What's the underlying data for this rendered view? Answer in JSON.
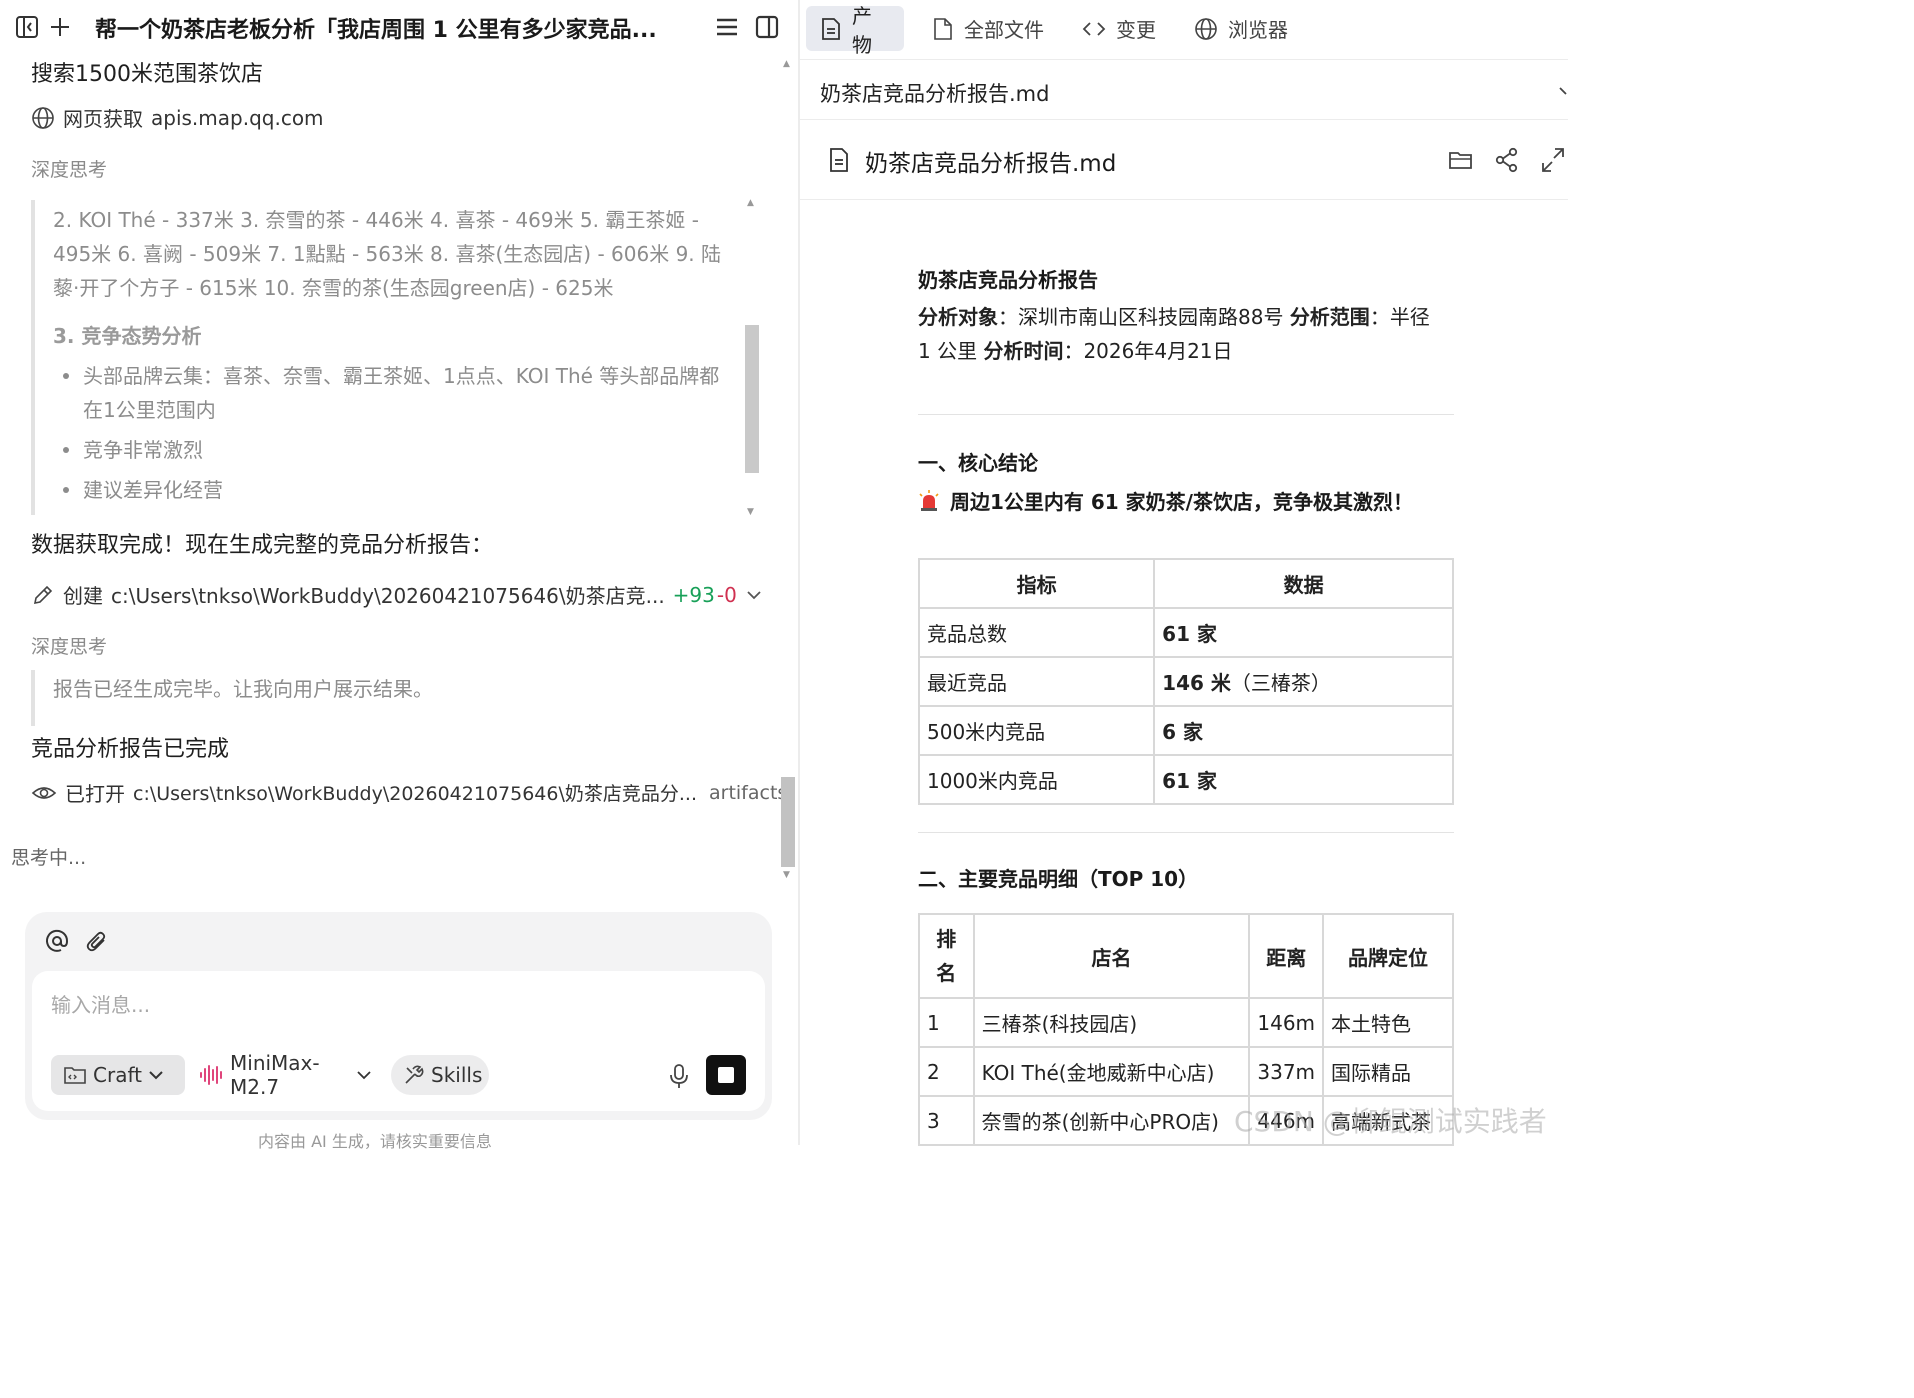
{
  "header": {
    "title": "帮一个奶茶店老板分析「我店周围 1 公里有多少家竞品..."
  },
  "chat": {
    "search_line": "搜索1500米范围茶饮店",
    "fetch_label": "网页获取",
    "fetch_domain": "apis.map.qq.com",
    "think_label_1": "深度思考",
    "think_text": "2. KOI Thé - 337米 3. 奈雪的茶 - 446米 4. 喜茶 - 469米 5. 霸王茶姬 - 495米 6. 喜阙 - 509米 7. 1點點 - 563米 8. 喜茶(生态园店) - 606米 9. 陆藜·开了个方子 - 615米 10. 奈雪的茶(生态园green店) - 625米",
    "think_section": "3. 竞争态势分析",
    "think_bullets": [
      "头部品牌云集：喜茶、奈雪、霸王茶姬、1点点、KOI Thé 等头部品牌都在1公里范围内",
      "竞争非常激烈",
      "建议差异化经营"
    ],
    "data_done": "数据获取完成！现在生成完整的竞品分析报告：",
    "create_label": "创建",
    "create_path": "c:\\Users\\tnkso\\WorkBuddy\\20260421075646\\奶茶店竞...",
    "create_add": "+93",
    "create_del": "-0",
    "think_label_2": "深度思考",
    "think_text_2": "报告已经生成完毕。让我向用户展示结果。",
    "report_done": "竞品分析报告已完成",
    "opened_label": "已打开",
    "opened_path": "c:\\Users\\tnkso\\WorkBuddy\\20260421075646\\奶茶店竞品分...",
    "opened_tag": "artifacts",
    "thinking": "思考中..."
  },
  "composer": {
    "placeholder": "输入消息...",
    "mode": "Craft",
    "model": "MiniMax-M2.7",
    "skills": "Skills",
    "disclaimer": "内容由 AI 生成，请核实重要信息"
  },
  "tabs": [
    {
      "label": "产物",
      "icon": "document-icon",
      "active": true
    },
    {
      "label": "全部文件",
      "icon": "file-icon",
      "active": false
    },
    {
      "label": "变更",
      "icon": "code-icon",
      "active": false
    },
    {
      "label": "浏览器",
      "icon": "globe-icon",
      "active": false
    }
  ],
  "file_select": "奶茶店竞品分析报告.md",
  "doc_name": "奶茶店竞品分析报告.md",
  "report": {
    "title": "奶茶店竞品分析报告",
    "meta_target_label": "分析对象",
    "meta_target": "深圳市南山区科技园南路88号",
    "meta_range_label": "分析范围",
    "meta_range": "半径 1 公里",
    "meta_time_label": "分析时间",
    "meta_time": "2026年4月21日",
    "section1": "一、核心结论",
    "callout": "周边1公里内有 61 家奶茶/茶饮店，竞争极其激烈！",
    "table1": {
      "headers": [
        "指标",
        "数据"
      ],
      "rows": [
        [
          "竞品总数",
          "61 家",
          ""
        ],
        [
          "最近竞品",
          "146 米",
          "（三椿茶）"
        ],
        [
          "500米内竞品",
          "6 家",
          ""
        ],
        [
          "1000米内竞品",
          "61 家",
          ""
        ]
      ]
    },
    "section2": "二、主要竞品明细（TOP 10）",
    "table2": {
      "headers": [
        "排名",
        "店名",
        "距离",
        "品牌定位"
      ],
      "rows": [
        [
          "1",
          "三椿茶(科技园店)",
          "146m",
          "本土特色"
        ],
        [
          "2",
          "KOI Thé(金地威新中心店)",
          "337m",
          "国际精品"
        ],
        [
          "3",
          "奈雪的茶(创新中心PRO店)",
          "446m",
          "高端新式茶"
        ]
      ]
    }
  },
  "watermark": "CSDN @柳鲲测试实践者",
  "colors": {
    "accent_add": "#18a058",
    "accent_del": "#d03050",
    "tab_active_bg": "#e8eaf0"
  }
}
